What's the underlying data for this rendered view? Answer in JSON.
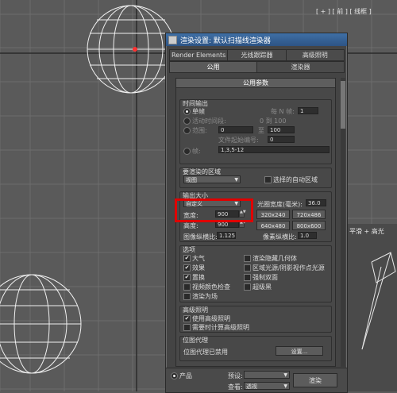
{
  "viewport": {
    "top_right_label": "[ + ] [ 前 ] [ 线框 ]",
    "right_label": "平滑 + 高光"
  },
  "dialog": {
    "title": "渲染设置: 默认扫描线渲染器",
    "tabs_row1": [
      "Render Elements",
      "光线跟踪器",
      "高级照明"
    ],
    "tabs_row2": [
      "公用",
      "渲染器"
    ],
    "rollout_title": "公用参数",
    "time_output": {
      "group": "时间输出",
      "single": "单帧",
      "every_n_label": "每 N 帧:",
      "every_n_value": "1",
      "active_segment": "活动时间段:",
      "active_range": "0 到 100",
      "range": "范围:",
      "range_from": "0",
      "range_to_label": "至",
      "range_to": "100",
      "file_start_label": "文件起始编号:",
      "file_start_value": "0",
      "frames": "帧:",
      "frames_value": "1,3,5-12"
    },
    "area": {
      "group": "要渲染的区域",
      "mode": "视图",
      "auto_region": "选择的自动区域"
    },
    "output_size": {
      "group": "输出大小",
      "preset": "自定义",
      "aperture_label": "光圈宽度(毫米):",
      "aperture_value": "36.0",
      "width_label": "宽度:",
      "width_value": "900",
      "height_label": "高度:",
      "height_value": "900",
      "presets": [
        "320x240",
        "720x486",
        "640x480",
        "800x600"
      ],
      "image_aspect_label": "图像纵横比:",
      "image_aspect_value": "1.125",
      "pixel_aspect_label": "像素纵横比:",
      "pixel_aspect_value": "1.0"
    },
    "options": {
      "group": "选项",
      "left": [
        {
          "label": "大气",
          "checked": true
        },
        {
          "label": "效果",
          "checked": true
        },
        {
          "label": "置换",
          "checked": true
        },
        {
          "label": "视频颜色检查",
          "checked": false
        },
        {
          "label": "渲染为场",
          "checked": false
        }
      ],
      "right": [
        {
          "label": "渲染隐藏几何体",
          "checked": false
        },
        {
          "label": "区域光源/阴影视作点光源",
          "checked": false
        },
        {
          "label": "强制双面",
          "checked": false
        },
        {
          "label": "超级黑",
          "checked": false
        }
      ]
    },
    "advanced_lighting": {
      "group": "高级照明",
      "use": {
        "label": "使用高级照明",
        "checked": true
      },
      "compute": {
        "label": "需要时计算高级照明",
        "checked": false
      }
    },
    "bitmap_proxy": {
      "group": "位图代理",
      "status": "位图代理已禁用",
      "setup_button": "设置..."
    },
    "bottom": {
      "product": "产品",
      "preset_label": "预设:",
      "viewport_label": "查看:",
      "viewport_value": "透视",
      "render_button": "渲染"
    }
  }
}
